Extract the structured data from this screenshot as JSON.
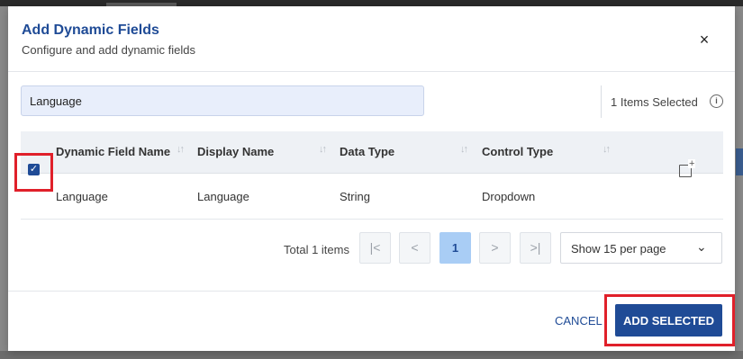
{
  "modal": {
    "title": "Add Dynamic Fields",
    "subtitle": "Configure and add dynamic fields",
    "close_icon": "×"
  },
  "search": {
    "value": "Language",
    "placeholder": ""
  },
  "selection": {
    "count_text": "1 Items Selected",
    "info_icon": "i"
  },
  "table": {
    "columns": [
      "Dynamic Field Name",
      "Display Name",
      "Data Type",
      "Control Type"
    ],
    "sort_icon": "↓↑",
    "rows": [
      {
        "checked": true,
        "check_glyph": "✓",
        "field_name": "Language",
        "display_name": "Language",
        "data_type": "String",
        "control_type": "Dropdown",
        "action_icon": "+"
      }
    ]
  },
  "pagination": {
    "total_text": "Total 1 items",
    "first": "|<",
    "prev": "<",
    "current": "1",
    "next": ">",
    "last": ">|",
    "per_page": "Show 15 per page",
    "per_page_caret": "⌄"
  },
  "footer": {
    "cancel_label": "CANCEL",
    "add_label": "ADD SELECTED"
  },
  "colors": {
    "accent": "#1f4b96",
    "highlight": "#e0202a",
    "search_bg": "#e8eefb",
    "active_page": "#a9cdf5"
  }
}
